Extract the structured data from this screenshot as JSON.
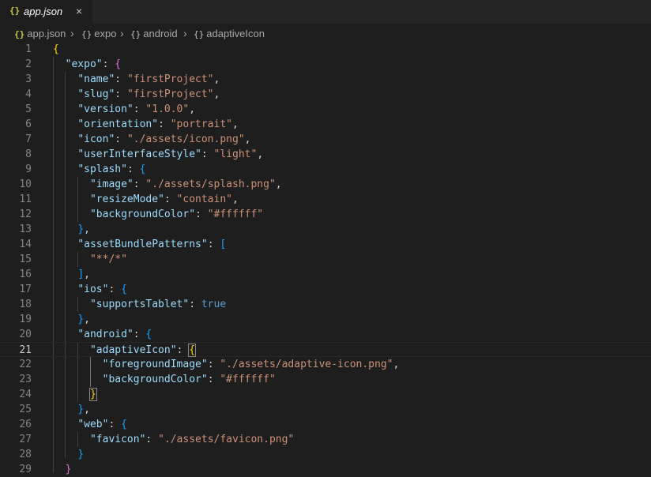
{
  "tab": {
    "icon": "{}",
    "label": "app.json",
    "close": "×"
  },
  "breadcrumb": [
    {
      "icon": "{}",
      "label": "app.json"
    },
    {
      "icon": "{}",
      "label": "expo"
    },
    {
      "icon": "{}",
      "label": "android"
    },
    {
      "icon": "{}",
      "label": "adaptiveIcon"
    }
  ],
  "breadcrumb_separator": "›",
  "editor": {
    "current_line": 21,
    "lines": [
      [
        [
          "{",
          "br1"
        ]
      ],
      [
        [
          "  ",
          "p"
        ],
        [
          "\"expo\"",
          "k"
        ],
        [
          ": ",
          "p"
        ],
        [
          "{",
          "br2"
        ]
      ],
      [
        [
          "    ",
          "p"
        ],
        [
          "\"name\"",
          "k"
        ],
        [
          ": ",
          "p"
        ],
        [
          "\"firstProject\"",
          "s"
        ],
        [
          ",",
          "p"
        ]
      ],
      [
        [
          "    ",
          "p"
        ],
        [
          "\"slug\"",
          "k"
        ],
        [
          ": ",
          "p"
        ],
        [
          "\"firstProject\"",
          "s"
        ],
        [
          ",",
          "p"
        ]
      ],
      [
        [
          "    ",
          "p"
        ],
        [
          "\"version\"",
          "k"
        ],
        [
          ": ",
          "p"
        ],
        [
          "\"1.0.0\"",
          "s"
        ],
        [
          ",",
          "p"
        ]
      ],
      [
        [
          "    ",
          "p"
        ],
        [
          "\"orientation\"",
          "k"
        ],
        [
          ": ",
          "p"
        ],
        [
          "\"portrait\"",
          "s"
        ],
        [
          ",",
          "p"
        ]
      ],
      [
        [
          "    ",
          "p"
        ],
        [
          "\"icon\"",
          "k"
        ],
        [
          ": ",
          "p"
        ],
        [
          "\"./assets/icon.png\"",
          "s"
        ],
        [
          ",",
          "p"
        ]
      ],
      [
        [
          "    ",
          "p"
        ],
        [
          "\"userInterfaceStyle\"",
          "k"
        ],
        [
          ": ",
          "p"
        ],
        [
          "\"light\"",
          "s"
        ],
        [
          ",",
          "p"
        ]
      ],
      [
        [
          "    ",
          "p"
        ],
        [
          "\"splash\"",
          "k"
        ],
        [
          ": ",
          "p"
        ],
        [
          "{",
          "br3"
        ]
      ],
      [
        [
          "      ",
          "p"
        ],
        [
          "\"image\"",
          "k"
        ],
        [
          ": ",
          "p"
        ],
        [
          "\"./assets/splash.png\"",
          "s"
        ],
        [
          ",",
          "p"
        ]
      ],
      [
        [
          "      ",
          "p"
        ],
        [
          "\"resizeMode\"",
          "k"
        ],
        [
          ": ",
          "p"
        ],
        [
          "\"contain\"",
          "s"
        ],
        [
          ",",
          "p"
        ]
      ],
      [
        [
          "      ",
          "p"
        ],
        [
          "\"backgroundColor\"",
          "k"
        ],
        [
          ": ",
          "p"
        ],
        [
          "\"#ffffff\"",
          "s"
        ]
      ],
      [
        [
          "    ",
          "p"
        ],
        [
          "}",
          "br3"
        ],
        [
          ",",
          "p"
        ]
      ],
      [
        [
          "    ",
          "p"
        ],
        [
          "\"assetBundlePatterns\"",
          "k"
        ],
        [
          ": ",
          "p"
        ],
        [
          "[",
          "br3"
        ]
      ],
      [
        [
          "      ",
          "p"
        ],
        [
          "\"**/*\"",
          "s"
        ]
      ],
      [
        [
          "    ",
          "p"
        ],
        [
          "]",
          "br3"
        ],
        [
          ",",
          "p"
        ]
      ],
      [
        [
          "    ",
          "p"
        ],
        [
          "\"ios\"",
          "k"
        ],
        [
          ": ",
          "p"
        ],
        [
          "{",
          "br3"
        ]
      ],
      [
        [
          "      ",
          "p"
        ],
        [
          "\"supportsTablet\"",
          "k"
        ],
        [
          ": ",
          "p"
        ],
        [
          "true",
          "b"
        ]
      ],
      [
        [
          "    ",
          "p"
        ],
        [
          "}",
          "br3"
        ],
        [
          ",",
          "p"
        ]
      ],
      [
        [
          "    ",
          "p"
        ],
        [
          "\"android\"",
          "k"
        ],
        [
          ": ",
          "p"
        ],
        [
          "{",
          "br3"
        ]
      ],
      [
        [
          "      ",
          "p"
        ],
        [
          "\"adaptiveIcon\"",
          "k"
        ],
        [
          ": ",
          "p"
        ],
        [
          "{",
          "br1 brm"
        ]
      ],
      [
        [
          "        ",
          "p"
        ],
        [
          "\"foregroundImage\"",
          "k"
        ],
        [
          ": ",
          "p"
        ],
        [
          "\"./assets/adaptive-icon.png\"",
          "s"
        ],
        [
          ",",
          "p"
        ]
      ],
      [
        [
          "        ",
          "p"
        ],
        [
          "\"backgroundColor\"",
          "k"
        ],
        [
          ": ",
          "p"
        ],
        [
          "\"#ffffff\"",
          "s"
        ]
      ],
      [
        [
          "      ",
          "p"
        ],
        [
          "}",
          "br1 brm"
        ]
      ],
      [
        [
          "    ",
          "p"
        ],
        [
          "}",
          "br3"
        ],
        [
          ",",
          "p"
        ]
      ],
      [
        [
          "    ",
          "p"
        ],
        [
          "\"web\"",
          "k"
        ],
        [
          ": ",
          "p"
        ],
        [
          "{",
          "br3"
        ]
      ],
      [
        [
          "      ",
          "p"
        ],
        [
          "\"favicon\"",
          "k"
        ],
        [
          ": ",
          "p"
        ],
        [
          "\"./assets/favicon.png\"",
          "s"
        ]
      ],
      [
        [
          "    ",
          "p"
        ],
        [
          "}",
          "br3"
        ]
      ],
      [
        [
          "  ",
          "p"
        ],
        [
          "}",
          "br2"
        ]
      ]
    ]
  },
  "colors": {
    "background": "#1e1e1e",
    "key": "#9cdcfe",
    "string": "#ce9178",
    "boolean": "#569cd6",
    "bracket_gold": "#ffd700",
    "bracket_purple": "#da70d6",
    "bracket_blue": "#179fff"
  }
}
